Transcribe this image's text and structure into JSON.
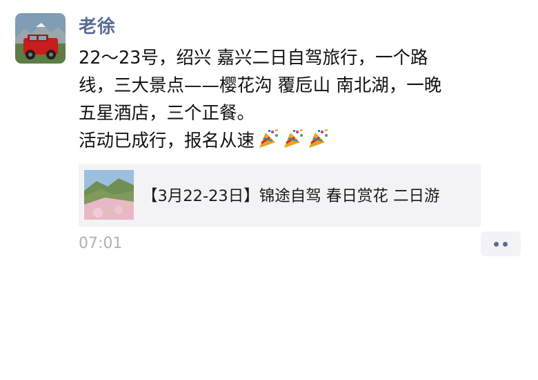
{
  "post": {
    "author": "老徐",
    "avatar_icon": "avatar-red-jeep-photo",
    "text_lines": [
      "22～23号，绍兴  嘉兴二日自驾旅行，一个路",
      "线，三大景点——樱花沟  覆卮山   南北湖，一晚",
      "五星酒店，三个正餐。",
      "活动已成行，报名从速"
    ],
    "emoji_icon": "party-popper-icon",
    "link_card": {
      "thumbnail_icon": "cherry-blossom-valley-photo",
      "title": "【3月22-23日】锦途自驾 春日赏花 二日游"
    },
    "timestamp": "07:01",
    "more_icon": "more-dots-icon"
  },
  "colors": {
    "name_link": "#576b95",
    "card_bg": "#f3f3f5",
    "timestamp": "#b2b2b2"
  }
}
